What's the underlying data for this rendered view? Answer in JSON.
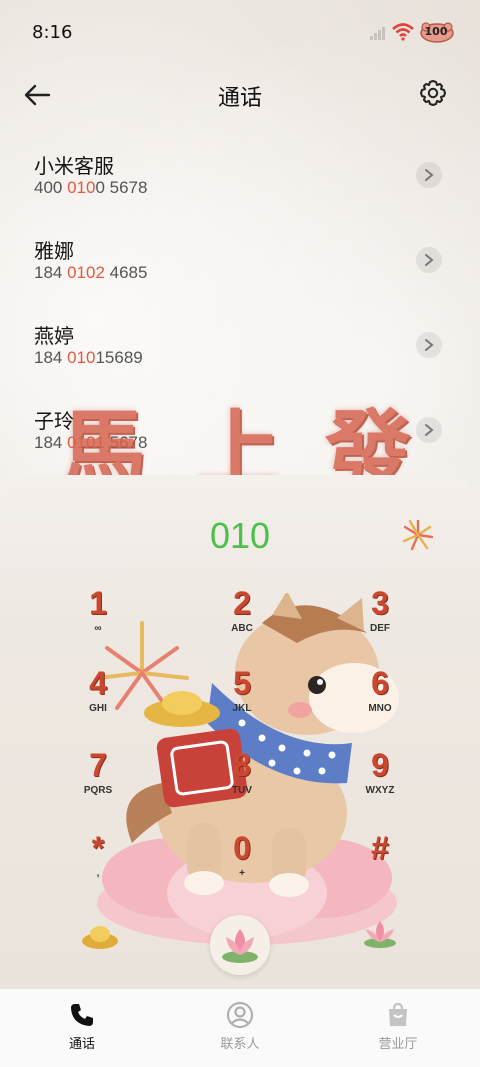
{
  "status_bar": {
    "time": "8:16",
    "battery": "100"
  },
  "header": {
    "title": "通话"
  },
  "call_log": [
    {
      "name": "小米客服",
      "number_parts": [
        "400 ",
        "010",
        "0 5678"
      ]
    },
    {
      "name": "雅娜",
      "number_parts": [
        "184 ",
        "0102",
        " 4685"
      ]
    },
    {
      "name": "燕婷",
      "number_parts": [
        "184 ",
        "010",
        "15689"
      ]
    },
    {
      "name": "子玲",
      "number_parts": [
        "184 ",
        "0101",
        " 5678"
      ]
    }
  ],
  "banner": {
    "chars": [
      "馬",
      "上",
      "發"
    ]
  },
  "dialpad": {
    "display": "010",
    "keys": [
      {
        "digit": "1",
        "letters": "∞"
      },
      {
        "digit": "2",
        "letters": "ABC"
      },
      {
        "digit": "3",
        "letters": "DEF"
      },
      {
        "digit": "4",
        "letters": "GHI"
      },
      {
        "digit": "5",
        "letters": "JKL"
      },
      {
        "digit": "6",
        "letters": "MNO"
      },
      {
        "digit": "7",
        "letters": "PQRS"
      },
      {
        "digit": "8",
        "letters": "TUV"
      },
      {
        "digit": "9",
        "letters": "WXYZ"
      },
      {
        "digit": "*",
        "letters": ","
      },
      {
        "digit": "0",
        "letters": "+"
      },
      {
        "digit": "#",
        "letters": ""
      }
    ]
  },
  "bottom_nav": [
    {
      "label": "通话",
      "icon": "phone-icon",
      "active": true
    },
    {
      "label": "联系人",
      "icon": "contact-icon",
      "active": false
    },
    {
      "label": "营业厅",
      "icon": "store-icon",
      "active": false
    }
  ],
  "colors": {
    "accent_green": "#4bc04b",
    "highlight_red": "#e05a40",
    "key_red": "#c9482f"
  }
}
